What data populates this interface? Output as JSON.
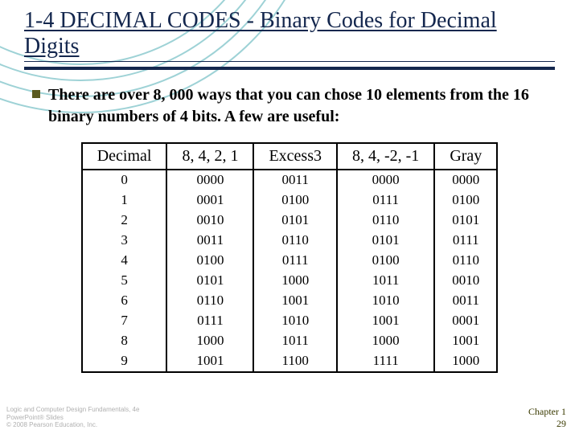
{
  "title": "1-4 DECIMAL CODES - Binary Codes for Decimal Digits",
  "bullet": "There are over 8, 000 ways that you can chose 10 elements from the 16 binary numbers of 4 bits.   A few are useful:",
  "table": {
    "headers": [
      "Decimal",
      "8, 4, 2, 1",
      "Excess3",
      "8, 4, -2, -1",
      "Gray"
    ],
    "rows": [
      [
        "0",
        "0000",
        "0011",
        "0000",
        "0000"
      ],
      [
        "1",
        "0001",
        "0100",
        "0111",
        "0100"
      ],
      [
        "2",
        "0010",
        "0101",
        "0110",
        "0101"
      ],
      [
        "3",
        "0011",
        "0110",
        "0101",
        "0111"
      ],
      [
        "4",
        "0100",
        "0111",
        "0100",
        "0110"
      ],
      [
        "5",
        "0101",
        "1000",
        "1011",
        "0010"
      ],
      [
        "6",
        "0110",
        "1001",
        "1010",
        "0011"
      ],
      [
        "7",
        "0111",
        "1010",
        "1001",
        "0001"
      ],
      [
        "8",
        "1000",
        "1011",
        "1000",
        "1001"
      ],
      [
        "9",
        "1001",
        "1100",
        "1111",
        "1000"
      ]
    ]
  },
  "footer_left_l1": "Logic and Computer Design Fundamentals, 4e",
  "footer_left_l2": "PowerPoint® Slides",
  "footer_left_l3": "© 2008 Pearson Education, Inc.",
  "footer_right_chapter": "Chapter 1",
  "footer_right_page": "29",
  "chart_data": {
    "type": "table",
    "title": "Binary Codes for Decimal Digits",
    "columns": [
      "Decimal",
      "8,4,2,1 (BCD)",
      "Excess-3",
      "8,4,-2,-1",
      "Gray"
    ],
    "rows": [
      {
        "Decimal": 0,
        "8421": "0000",
        "Excess3": "0011",
        "84-2-1": "0000",
        "Gray": "0000"
      },
      {
        "Decimal": 1,
        "8421": "0001",
        "Excess3": "0100",
        "84-2-1": "0111",
        "Gray": "0100"
      },
      {
        "Decimal": 2,
        "8421": "0010",
        "Excess3": "0101",
        "84-2-1": "0110",
        "Gray": "0101"
      },
      {
        "Decimal": 3,
        "8421": "0011",
        "Excess3": "0110",
        "84-2-1": "0101",
        "Gray": "0111"
      },
      {
        "Decimal": 4,
        "8421": "0100",
        "Excess3": "0111",
        "84-2-1": "0100",
        "Gray": "0110"
      },
      {
        "Decimal": 5,
        "8421": "0101",
        "Excess3": "1000",
        "84-2-1": "1011",
        "Gray": "0010"
      },
      {
        "Decimal": 6,
        "8421": "0110",
        "Excess3": "1001",
        "84-2-1": "1010",
        "Gray": "0011"
      },
      {
        "Decimal": 7,
        "8421": "0111",
        "Excess3": "1010",
        "84-2-1": "1001",
        "Gray": "0001"
      },
      {
        "Decimal": 8,
        "8421": "1000",
        "Excess3": "1011",
        "84-2-1": "1000",
        "Gray": "1001"
      },
      {
        "Decimal": 9,
        "8421": "1001",
        "Excess3": "1100",
        "84-2-1": "1111",
        "Gray": "1000"
      }
    ]
  }
}
